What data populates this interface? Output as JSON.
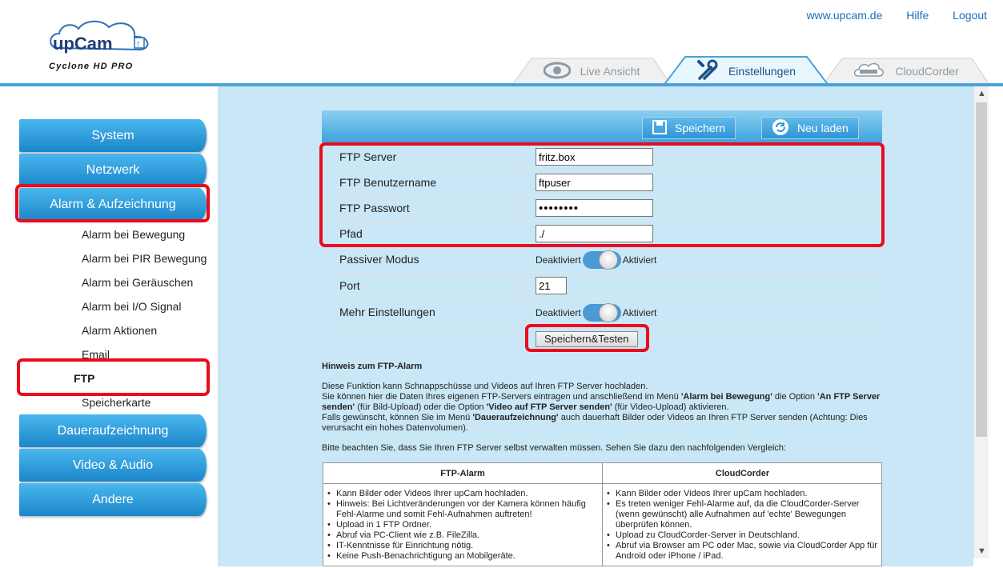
{
  "header": {
    "logo_text": "upCam",
    "logo_subtitle": "Cyclone HD PRO",
    "links": [
      "www.upcam.de",
      "Hilfe",
      "Logout"
    ]
  },
  "tabs": [
    {
      "label": "Live Ansicht",
      "icon": "eye-icon",
      "active": false
    },
    {
      "label": "Einstellungen",
      "icon": "tools-icon",
      "active": true
    },
    {
      "label": "CloudCorder",
      "icon": "cloudcorder-icon",
      "active": false
    }
  ],
  "sidebar": {
    "main_items": [
      "System",
      "Netzwerk",
      "Alarm & Aufzeichnung",
      "Daueraufzeichnung",
      "Video & Audio",
      "Andere"
    ],
    "sub_items": [
      "Alarm bei Bewegung",
      "Alarm bei PIR Bewegung",
      "Alarm bei Geräuschen",
      "Alarm bei I/O Signal",
      "Alarm Aktionen",
      "Email",
      "FTP",
      "Speicherkarte"
    ],
    "active_sub": "FTP"
  },
  "toolbar": {
    "save_label": "Speichern",
    "reload_label": "Neu laden"
  },
  "form": {
    "server_label": "FTP Server",
    "server_value": "fritz.box",
    "user_label": "FTP Benutzername",
    "user_value": "ftpuser",
    "password_label": "FTP Passwort",
    "password_value": "••••••••",
    "path_label": "Pfad",
    "path_value": "./",
    "passive_label": "Passiver Modus",
    "port_label": "Port",
    "port_value": "21",
    "more_label": "Mehr Einstellungen",
    "toggle_off": "Deaktiviert",
    "toggle_on": "Aktiviert",
    "test_button": "Speichern&Testen"
  },
  "hint": {
    "title": "Hinweis zum FTP-Alarm",
    "p1_a": "Diese Funktion kann Schnappschüsse und Videos auf Ihren FTP Server hochladen.",
    "p1_b": "Sie können hier die Daten Ihres eigenen FTP-Servers eintragen und anschließend im Menü ",
    "p1_b_bold": "'Alarm bei Bewegung'",
    "p1_c": " die Option ",
    "p1_c_bold": "'An FTP Server senden'",
    "p1_d": " (für Bild-Upload) oder die Option ",
    "p1_d_bold": "'Video auf FTP Server senden'",
    "p1_e": " (für Video-Upload) aktivieren.",
    "p1_f": "Falls gewünscht, können Sie im Menü ",
    "p1_f_bold": "'Daueraufzeichnung'",
    "p1_g": " auch dauerhaft Bilder oder Videos an Ihren FTP Server senden (Achtung: Dies verursacht ein hohes Datenvolumen).",
    "p2": "Bitte beachten Sie, dass Sie Ihren FTP Server selbst verwalten müssen. Sehen Sie dazu den nachfolgenden Vergleich:"
  },
  "compare": {
    "left_head": "FTP-Alarm",
    "right_head": "CloudCorder",
    "left_items": [
      "Kann Bilder oder Videos Ihrer upCam hochladen.",
      "Hinweis: Bei Lichtveränderungen vor der Kamera können häufig Fehl-Alarme und somit Fehl-Aufnahmen auftreten!",
      "Upload in 1 FTP Ordner.",
      "Abruf via PC-Client wie z.B. FileZilla.",
      "IT-Kenntnisse für Einrichtung nötig.",
      "Keine Push-Benachrichtigung an Mobilgeräte."
    ],
    "right_items": [
      "Kann Bilder oder Videos Ihrer upCam hochladen.",
      "Es treten weniger Fehl-Alarme auf, da die CloudCorder-Server (wenn gewünscht) alle Aufnahmen auf 'echte' Bewegungen überprüfen können.",
      "Upload zu CloudCorder-Server in Deutschland.",
      "Abruf via Browser am PC oder Mac, sowie via CloudCorder App für Android oder iPhone / iPad."
    ]
  },
  "colors": {
    "accent_blue": "#2a97d8",
    "highlight_red": "#ea0b1d",
    "content_bg": "#c9e7f6"
  }
}
